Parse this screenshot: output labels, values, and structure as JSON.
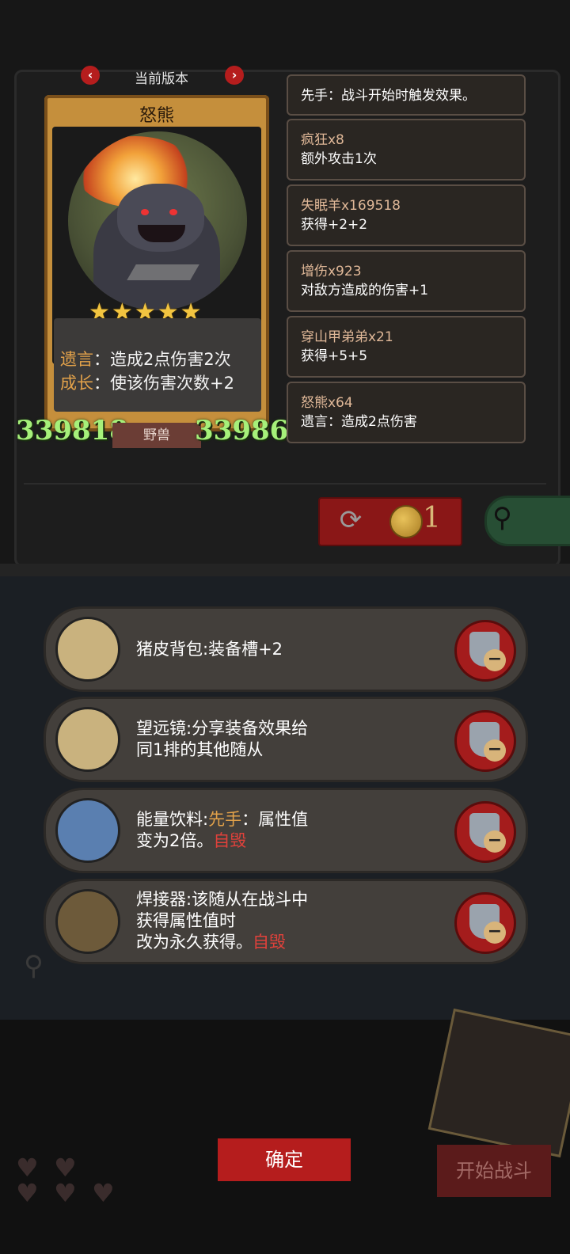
{
  "version_selector": {
    "label": "当前版本",
    "prev": "‹",
    "next": "›"
  },
  "card": {
    "name": "怒熊",
    "stars": 5,
    "abilities": [
      {
        "key": "遗言",
        "sep": "：",
        "text": "造成2点伤害2次"
      },
      {
        "key": "成长",
        "sep": "：",
        "text": "使该伤害次数+2"
      }
    ],
    "attack": "339818",
    "health": "33986",
    "tribe": "野兽"
  },
  "buffs": [
    {
      "name": "",
      "desc": "先手：战斗开始时触发效果。"
    },
    {
      "name": "疯狂x8",
      "desc": "额外攻击1次"
    },
    {
      "name": "失眠羊x169518",
      "desc": "获得+2+2"
    },
    {
      "name": "增伤x923",
      "desc": "对敌方造成的伤害+1"
    },
    {
      "name": "穿山甲弟弟x21",
      "desc": "获得+5+5"
    },
    {
      "name": "怒熊x64",
      "desc": "遗言：造成2点伤害"
    }
  ],
  "shop": {
    "coin_count": "1"
  },
  "equipment": [
    {
      "lines": [
        {
          "segments": [
            {
              "t": "猪皮背包:装备槽+2",
              "c": ""
            }
          ]
        }
      ],
      "icon": "backpack-icon"
    },
    {
      "lines": [
        {
          "segments": [
            {
              "t": "望远镜:分享装备效果给",
              "c": ""
            }
          ]
        },
        {
          "segments": [
            {
              "t": "同1排的其他随从",
              "c": ""
            }
          ]
        }
      ],
      "icon": "telescope-icon"
    },
    {
      "lines": [
        {
          "segments": [
            {
              "t": "能量饮料:",
              "c": ""
            },
            {
              "t": "先手",
              "c": "hl"
            },
            {
              "t": "：属性值",
              "c": ""
            }
          ]
        },
        {
          "segments": [
            {
              "t": "变为2倍。",
              "c": ""
            },
            {
              "t": "自毁",
              "c": "red"
            }
          ]
        }
      ],
      "icon": "energy-drink-icon"
    },
    {
      "lines": [
        {
          "segments": [
            {
              "t": "焊接器:该随从在战斗中",
              "c": ""
            }
          ]
        },
        {
          "segments": [
            {
              "t": "获得属性值时",
              "c": ""
            }
          ]
        },
        {
          "segments": [
            {
              "t": "改为永久获得。",
              "c": ""
            },
            {
              "t": "自毁",
              "c": "red"
            }
          ]
        }
      ],
      "icon": "welder-icon"
    }
  ],
  "buttons": {
    "confirm": "确定",
    "start_battle": "开始战斗"
  },
  "colors": {
    "accent_red": "#b51d1d",
    "stat_green": "#a6f07a",
    "keyword_orange": "#e3a24a"
  }
}
